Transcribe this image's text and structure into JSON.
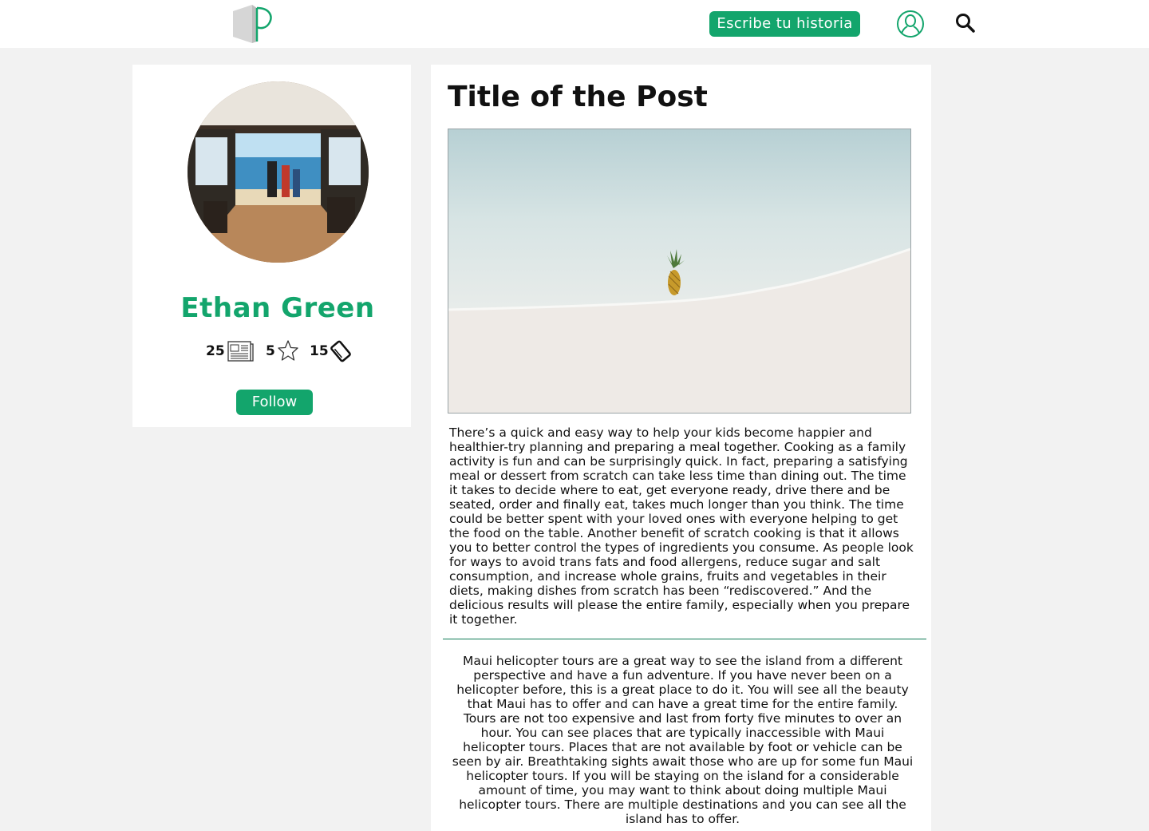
{
  "header": {
    "logo": "p-logo-icon",
    "write_label": "Escribe tu historia",
    "user_icon": "user-icon",
    "search_icon": "search-icon"
  },
  "profile": {
    "name": "Ethan Green",
    "stats": {
      "posts": "25",
      "stars": "5",
      "bookmarks": "15"
    },
    "follow_label": "Follow"
  },
  "post": {
    "title": "Title of the Post",
    "paragraph_1": "There’s a quick and easy way to help your kids become happier and healthier-try planning and preparing a meal together. Cooking as a family activity is fun and can be surprisingly quick. In fact, preparing a satisfying meal or dessert from scratch can take less time than dining out. The time it takes to decide where to eat, get everyone ready, drive there and be seated, order and finally eat, takes much longer than you think. The time could be better spent with your loved ones with everyone helping to get the food on the table. Another benefit of scratch cooking is that it allows you to better control the types of ingredients you consume. As people look for ways to avoid trans fats and food allergens, reduce sugar and salt consumption, and increase whole grains, fruits and vegetables in their diets, making dishes from scratch has been “rediscovered.” And the delicious results will please the entire family, especially when you prepare it together.",
    "paragraph_2": "Maui helicopter tours are a great way to see the island from a different perspective and have a fun adventure. If you have never been on a helicopter before, this is a great place to do it. You will see all the beauty that Maui has to offer and can have a great time for the entire family. Tours are not too expensive and last from forty five minutes to over an hour. You can see places that are typically inaccessible with Maui helicopter tours. Places that are not available by foot or vehicle can be seen by air. Breathtaking sights await those who are up for some fun Maui helicopter tours. If you will be staying on the island for a considerable amount of time, you may want to think about doing multiple Maui helicopter tours. There are multiple destinations and you can see all the island has to offer."
  },
  "colors": {
    "accent": "#13a56c",
    "divider": "#0e7a55",
    "background": "#f2f2f2"
  }
}
